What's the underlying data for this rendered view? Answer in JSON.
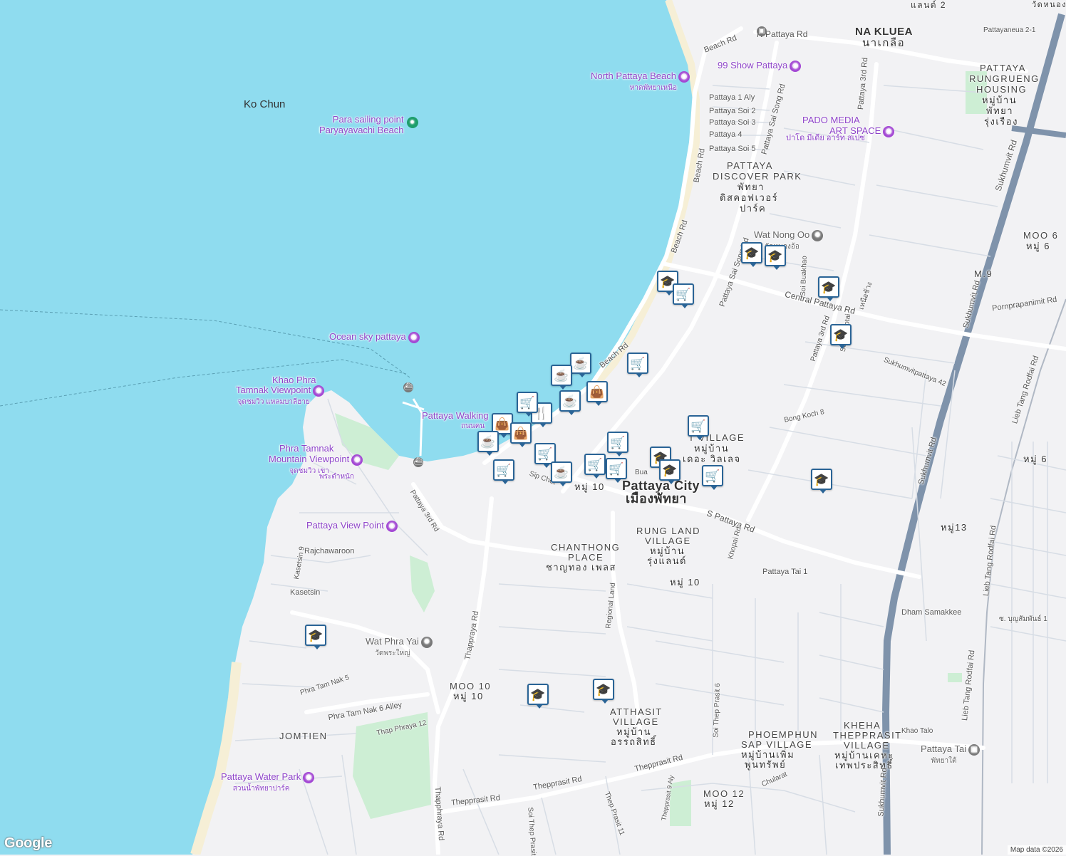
{
  "colors": {
    "water": "#8fdcef",
    "land": "#f2f2f4",
    "park": "#cdeed4",
    "beach": "#f6efd6",
    "highway": "#7f93ab",
    "road": "#ffffff",
    "minor_road": "#d7dde5",
    "poi_purple": "#a347d4",
    "marker_border": "#2a6496"
  },
  "water_labels": [
    "Ko Chun"
  ],
  "area_labels": [
    {
      "id": "na-kluea",
      "text": "NA KLUEA"
    },
    {
      "id": "na-kluea-th",
      "text": "นาเกลือ"
    },
    {
      "id": "rungrueng-1",
      "text": "PATTAYA"
    },
    {
      "id": "rungrueng-2",
      "text": "RUNGRUENG"
    },
    {
      "id": "rungrueng-3",
      "text": "HOUSING"
    },
    {
      "id": "rungrueng-4",
      "text": "หมู่บ้าน"
    },
    {
      "id": "rungrueng-5",
      "text": "พัทยา"
    },
    {
      "id": "rungrueng-6",
      "text": "รุ่งเรือง"
    },
    {
      "id": "discover-1",
      "text": "PATTAYA"
    },
    {
      "id": "discover-2",
      "text": "DISCOVER PARK"
    },
    {
      "id": "discover-3",
      "text": "พัทยา"
    },
    {
      "id": "discover-4",
      "text": "ดิสคอฟเวอร์"
    },
    {
      "id": "discover-5",
      "text": "ปาร์ค"
    },
    {
      "id": "moo6-top",
      "text": "MOO 6"
    },
    {
      "id": "moo6-top-th",
      "text": "หมู่ 6"
    },
    {
      "id": "m9",
      "text": "M.9"
    },
    {
      "id": "moo6-right",
      "text": "หมู่ 6"
    },
    {
      "id": "moo13",
      "text": "หมู่13"
    },
    {
      "id": "village-1",
      "text": "T VILLAGE"
    },
    {
      "id": "village-2",
      "text": "หมู่บ้าน"
    },
    {
      "id": "village-3",
      "text": "เดอะ วิลเลจ"
    },
    {
      "id": "city",
      "text": "Pattaya City"
    },
    {
      "id": "city-th",
      "text": "เมืองพัทยา"
    },
    {
      "id": "moo10-center",
      "text": "หมู่ 10"
    },
    {
      "id": "rungland-1",
      "text": "RUNG LAND"
    },
    {
      "id": "rungland-2",
      "text": "VILLAGE"
    },
    {
      "id": "rungland-3",
      "text": "หมู่บ้าน"
    },
    {
      "id": "rungland-4",
      "text": "รุ่งแลนด์"
    },
    {
      "id": "chanthong-1",
      "text": "CHANTHONG"
    },
    {
      "id": "chanthong-2",
      "text": "PLACE"
    },
    {
      "id": "chanthong-3",
      "text": "ชาญทอง เพลส"
    },
    {
      "id": "moo10-mid",
      "text": "หมู่ 10"
    },
    {
      "id": "moo10-sw",
      "text": "MOO 10"
    },
    {
      "id": "moo10-sw-th",
      "text": "หมู่ 10"
    },
    {
      "id": "atthasit-1",
      "text": "ATTHASIT"
    },
    {
      "id": "atthasit-2",
      "text": "VILLAGE"
    },
    {
      "id": "atthasit-3",
      "text": "หมู่บ้าน"
    },
    {
      "id": "atthasit-4",
      "text": "อรรถสิทธิ์"
    },
    {
      "id": "jomtien",
      "text": "JOMTIEN"
    },
    {
      "id": "phoemphun-1",
      "text": "PHOEMPHUN"
    },
    {
      "id": "phoemphun-2",
      "text": "SAP VILLAGE"
    },
    {
      "id": "phoemphun-3",
      "text": "หมู่บ้านเพิ่ม"
    },
    {
      "id": "phoemphun-4",
      "text": "พูนทรัพย์"
    },
    {
      "id": "kheha-1",
      "text": "KHEHA"
    },
    {
      "id": "kheha-2",
      "text": "THEPPRASIT"
    },
    {
      "id": "kheha-3",
      "text": "VILLAGE"
    },
    {
      "id": "kheha-4",
      "text": "หมู่บ้านเคหะ"
    },
    {
      "id": "kheha-5",
      "text": "เทพประสิทธิ์"
    },
    {
      "id": "moo12",
      "text": "MOO 12"
    },
    {
      "id": "moo12-th",
      "text": "หมู่ 12"
    },
    {
      "id": "landmark-2",
      "text": "แลนด์ 2"
    },
    {
      "id": "corner-th",
      "text": "วัดหนองใ"
    }
  ],
  "poi_labels": [
    {
      "id": "para",
      "text": "Para sailing point",
      "sub": "Paryayavachi Beach",
      "icon": "landmark-icon"
    },
    {
      "id": "north-beach",
      "text": "North Pattaya Beach",
      "sub": "หาดพัทยาเหนือ",
      "icon": "camera-icon"
    },
    {
      "id": "show99",
      "text": "99 Show Pattaya",
      "sub": "",
      "icon": "camera-icon"
    },
    {
      "id": "pado",
      "text": "PADO MEDIA",
      "sub": "ART SPACE",
      "icon": "camera-icon"
    },
    {
      "id": "pado-th",
      "text": "ปาโด มีเดีย อาร์ท สเปซ",
      "sub": "",
      "icon": ""
    },
    {
      "id": "ocean",
      "text": "Ocean sky pattaya",
      "sub": "",
      "icon": "camera-icon"
    },
    {
      "id": "khao-phra",
      "text": "Khao Phra",
      "sub": "",
      "icon": ""
    },
    {
      "id": "tamnak-vp",
      "text": "Tamnak Viewpoint",
      "sub": "จุดชมวิว แหลมบาลีฮาย",
      "icon": "camera-icon"
    },
    {
      "id": "walking",
      "text": "Pattaya Walking",
      "sub": "ถนนคน",
      "icon": ""
    },
    {
      "id": "phra-tamnak-1",
      "text": "Phra Tamnak",
      "sub": "",
      "icon": ""
    },
    {
      "id": "phra-tamnak-2",
      "text": "Mountain Viewpoint",
      "sub": "จุดชมวิว เขา",
      "icon": "camera-icon"
    },
    {
      "id": "phra-tamnak-3",
      "text": "พระตำหนัก",
      "sub": "",
      "icon": ""
    },
    {
      "id": "view-point",
      "text": "Pattaya View Point",
      "sub": "",
      "icon": "camera-icon"
    },
    {
      "id": "wat-nong-oo",
      "text": "Wat Nong Oo",
      "sub": "วัดหนองอ้อ",
      "icon": "temple-icon"
    },
    {
      "id": "wat-phra-yai",
      "text": "Wat Phra Yai",
      "sub": "วัดพระใหญ่",
      "icon": "temple-icon"
    },
    {
      "id": "water-park",
      "text": "Pattaya Water Park",
      "sub": "สวนน้ำพัทยาปาร์ค",
      "icon": "camera-icon"
    },
    {
      "id": "pattaya-tai",
      "text": "Pattaya Tai",
      "sub": "พัทยาใต้",
      "icon": "train-icon"
    }
  ],
  "road_labels": [
    "N Pattaya Rd",
    "Beach Rd",
    "Pattaya 1 Aly",
    "Pattaya Soi 2",
    "Pattaya Soi 3",
    "Pattaya 4",
    "Pattaya Soi 5",
    "Pattaya Sai Song Rd",
    "Pattaya 3rd Rd",
    "Pattayaneua 2-1",
    "Beach Rd",
    "Beach Rd",
    "Pattaya Sai Song Rd",
    "Soi Buakhao",
    "Central Pattaya Rd",
    "Sukhumvit Rd",
    "Pornprapanimit Rd",
    "Sukhumvit Rd",
    "Sukhumvitpattaya 42",
    "Bong Koch 8",
    "Lieb Tang Rodfai Rd",
    "Sukhumvit Rd",
    "Beach Rd",
    "Pattaya 3rd Rd",
    "S Pattaya Rd",
    "Khopai Rd",
    "Pattaya Tai 1",
    "Dham Samakkee",
    "Lieb Tang Rodfai Rd",
    "ซ. บุญสัมพันธ์ 1",
    "Regional Land",
    "Thappraya Rd",
    "Rajchawaroon",
    "Kasetsin 9",
    "Kasetsin",
    "Phra Tam Nak 5",
    "Phra Tam Nak 6 Alley",
    "Thap Phraya 12",
    "Thepprasit Rd",
    "Thepprasit Rd",
    "Thepprasit Rd",
    "Thep Prasit 11",
    "Soi Thep Prasit 6",
    "Thepprasit 9 Aly",
    "Chularat",
    "Khao Talo",
    "Lieb Tang Rodfai Rd",
    "Sukhumvit Rd",
    "Thapphraya Rd",
    "Soi Thep Prasit",
    "Sip Chet",
    "Bua",
    "Pattaya 3rd Rd",
    "Soi Arunotai",
    "เหนือช้าง"
  ],
  "map_markers": [
    {
      "type": "school-icon"
    },
    {
      "type": "school-icon"
    },
    {
      "type": "school-icon"
    },
    {
      "type": "school-icon"
    },
    {
      "type": "cart-icon"
    },
    {
      "type": "school-icon"
    },
    {
      "type": "cart-icon"
    },
    {
      "type": "cafe-icon"
    },
    {
      "type": "cafe-icon"
    },
    {
      "type": "bag-icon"
    },
    {
      "type": "restaurant-icon"
    },
    {
      "type": "bag-icon"
    },
    {
      "type": "bag-icon"
    },
    {
      "type": "cafe-icon"
    },
    {
      "type": "cart-icon"
    },
    {
      "type": "cart-icon"
    },
    {
      "type": "cart-icon"
    },
    {
      "type": "cafe-icon"
    },
    {
      "type": "cart-icon"
    },
    {
      "type": "cart-icon"
    },
    {
      "type": "cart-icon"
    },
    {
      "type": "school-icon"
    },
    {
      "type": "school-icon"
    },
    {
      "type": "cart-icon"
    },
    {
      "type": "cart-icon"
    },
    {
      "type": "school-icon"
    },
    {
      "type": "school-icon"
    },
    {
      "type": "school-icon"
    },
    {
      "type": "school-icon"
    },
    {
      "type": "cart-icon"
    }
  ],
  "footer": {
    "logo": "Google",
    "credit": "Map data ©2026"
  }
}
